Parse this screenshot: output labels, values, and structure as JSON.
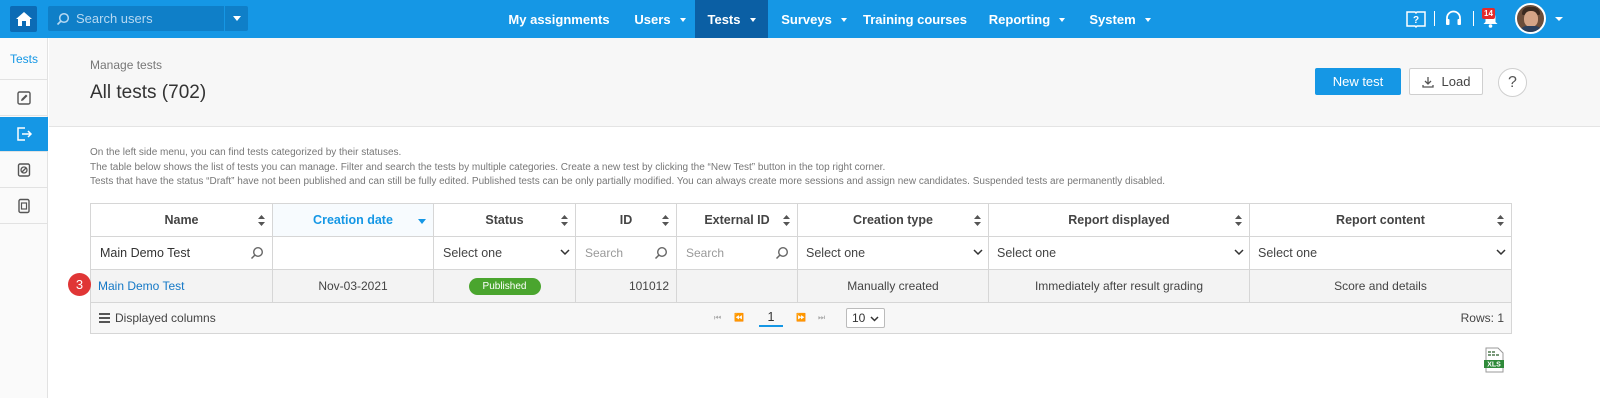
{
  "topbar": {
    "search_placeholder": "Search users",
    "nav": [
      {
        "label": "My assignments"
      },
      {
        "label": "Users"
      },
      {
        "label": "Tests"
      },
      {
        "label": "Surveys"
      },
      {
        "label": "Training courses"
      },
      {
        "label": "Reporting"
      },
      {
        "label": "System"
      }
    ],
    "notification_count": "14",
    "accent": "#1597e5",
    "active_nav": "#0b5fa4"
  },
  "sidebar": {
    "title": "Tests",
    "items": [
      {
        "icon": "edit-icon"
      },
      {
        "icon": "publish-icon"
      },
      {
        "icon": "shield-icon"
      },
      {
        "icon": "archive-icon"
      }
    ]
  },
  "header": {
    "breadcrumb": "Manage tests",
    "title": "All tests (702)",
    "new_test_label": "New test",
    "load_label": "Load",
    "help_label": "?"
  },
  "info": {
    "line1": "On the left side menu, you can find tests categorized by their statuses.",
    "line2": "The table below shows the list of tests you can manage. Filter and search the tests by multiple categories. Create a new test by clicking the “New Test” button in the top right corner.",
    "line3": "Tests that have the status “Draft” have not been published and can still be fully edited. Published tests can be only partially modified. You can always create more sessions and assign new candidates. Suspended tests are permanently disabled."
  },
  "table": {
    "columns": [
      "Name",
      "Creation date",
      "Status",
      "ID",
      "External ID",
      "Creation type",
      "Report displayed",
      "Report content"
    ],
    "filters": {
      "name": "Main Demo Test",
      "status": "Select one",
      "id_placeholder": "Search",
      "external_id_placeholder": "Search",
      "creation_type": "Select one",
      "report_displayed": "Select one",
      "report_content": "Select one"
    },
    "rows": [
      {
        "marker": "3",
        "name": "Main Demo Test",
        "creation_date": "Nov-03-2021",
        "status": "Published",
        "id": "101012",
        "external_id": "",
        "creation_type": "Manually created",
        "report_displayed": "Immediately after result grading",
        "report_content": "Score and details"
      }
    ],
    "footer": {
      "displayed_columns_label": "Displayed columns",
      "current_page": "1",
      "per_page": "10",
      "rows_label": "Rows: 1"
    }
  },
  "export": {
    "xls_label": "XLS"
  }
}
